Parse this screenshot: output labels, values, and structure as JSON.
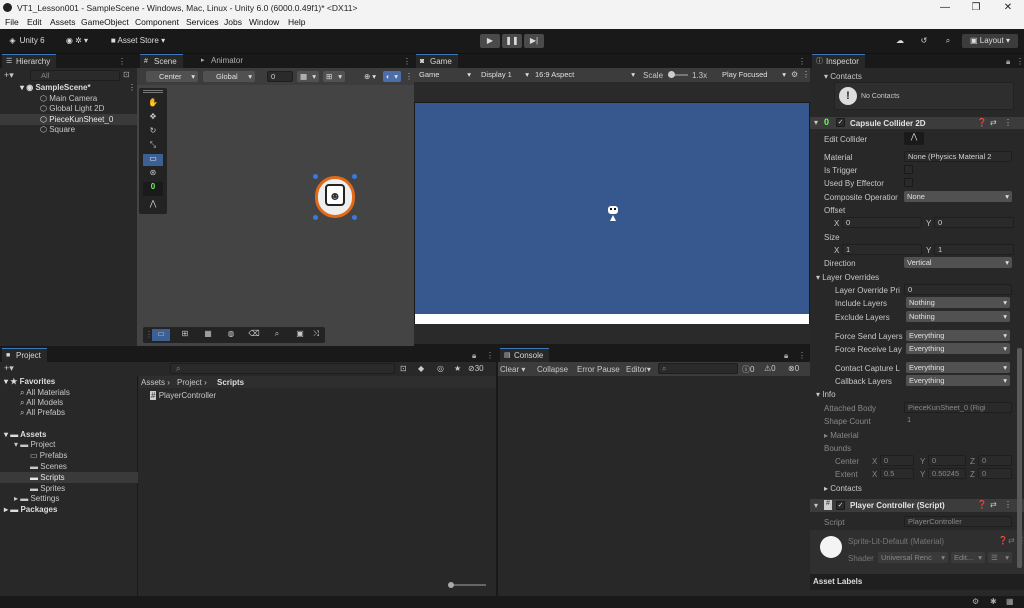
{
  "window": {
    "title": "VT1_Lesson001 - SampleScene - Windows, Mac, Linux - Unity 6.0 (6000.0.49f1)* <DX11>",
    "controls": [
      "—",
      "❐",
      "✕"
    ]
  },
  "menu": [
    "File",
    "Edit",
    "Assets",
    "GameObject",
    "Component",
    "Services",
    "Jobs",
    "Window",
    "Help"
  ],
  "toolbar": {
    "account": "Unity 6",
    "asset_store": "Asset Store",
    "layout": "Layout"
  },
  "hierarchy": {
    "tab": "Hierarchy",
    "search_placeholder": "All",
    "scene": "SampleScene*",
    "items": [
      "Main Camera",
      "Global Light 2D",
      "PieceKunSheet_0",
      "Square"
    ]
  },
  "scene": {
    "tab": "Scene",
    "tab2": "Animator",
    "pivot": "Center",
    "space": "Global",
    "snap": "0",
    "gizmo_count": "0"
  },
  "game": {
    "tab": "Game",
    "mode": "Game",
    "display": "Display 1",
    "aspect": "16:9 Aspect",
    "scale_label": "Scale",
    "scale_value": "1.3x",
    "play_mode": "Play Focused",
    "bg_color": "#37578f"
  },
  "inspector": {
    "tab": "Inspector",
    "contacts_header": "Contacts",
    "no_contacts": "No Contacts",
    "collider": {
      "title": "Capsule Collider 2D",
      "badge": "0",
      "edit_collider": "Edit Collider",
      "material_label": "Material",
      "material_value": "None (Physics Material 2",
      "is_trigger": "Is Trigger",
      "used_by_effector": "Used By Effector",
      "composite_label": "Composite Operatior",
      "composite_value": "None",
      "offset_label": "Offset",
      "offset_x": "0",
      "offset_y": "0",
      "size_label": "Size",
      "size_x": "1",
      "size_y": "1",
      "direction_label": "Direction",
      "direction_value": "Vertical",
      "layer_overrides": "Layer Overrides",
      "layer_override_priority": "Layer Override Pri",
      "layer_override_priority_value": "0",
      "include_layers": "Include Layers",
      "include_value": "Nothing",
      "exclude_layers": "Exclude Layers",
      "exclude_value": "Nothing",
      "force_send": "Force Send Layers",
      "force_send_value": "Everything",
      "force_receive": "Force Receive Lay",
      "force_receive_value": "Everything",
      "contact_capture": "Contact Capture L",
      "contact_capture_value": "Everything",
      "callback_layers": "Callback Layers",
      "callback_value": "Everything",
      "info": "Info",
      "attached_body": "Attached Body",
      "attached_body_value": "PieceKunSheet_0 (Rigi",
      "shape_count": "Shape Count",
      "shape_count_value": "1",
      "material_sub": "Material",
      "bounds": "Bounds",
      "center": "Center",
      "center_x": "0",
      "center_y": "0",
      "center_z": "0",
      "extent": "Extent",
      "extent_x": "0.5",
      "extent_y": "0.50245",
      "extent_z": "0",
      "contacts": "Contacts"
    },
    "script": {
      "title": "Player Controller (Script)",
      "script_label": "Script",
      "script_value": "PlayerController"
    },
    "material": {
      "name": "Sprite-Lit-Default (Material)",
      "shader_label": "Shader",
      "shader_value": "Universal Renc",
      "edit": "Edit..."
    },
    "asset_labels": "Asset Labels"
  },
  "project": {
    "tab": "Project",
    "favorites": "Favorites",
    "fav_items": [
      "All Materials",
      "All Models",
      "All Prefabs"
    ],
    "assets": "Assets",
    "tree": [
      "Project",
      "Prefabs",
      "Scenes",
      "Scripts",
      "Sprites",
      "Settings"
    ],
    "packages": "Packages",
    "breadcrumb": [
      "Assets",
      "Project",
      "Scripts"
    ],
    "files": [
      "PlayerController"
    ],
    "count": "30"
  },
  "console": {
    "tab": "Console",
    "clear": "Clear",
    "collapse": "Collapse",
    "error_pause": "Error Pause",
    "editor": "Editor",
    "logs": "0",
    "warnings": "0",
    "errors": "0"
  }
}
